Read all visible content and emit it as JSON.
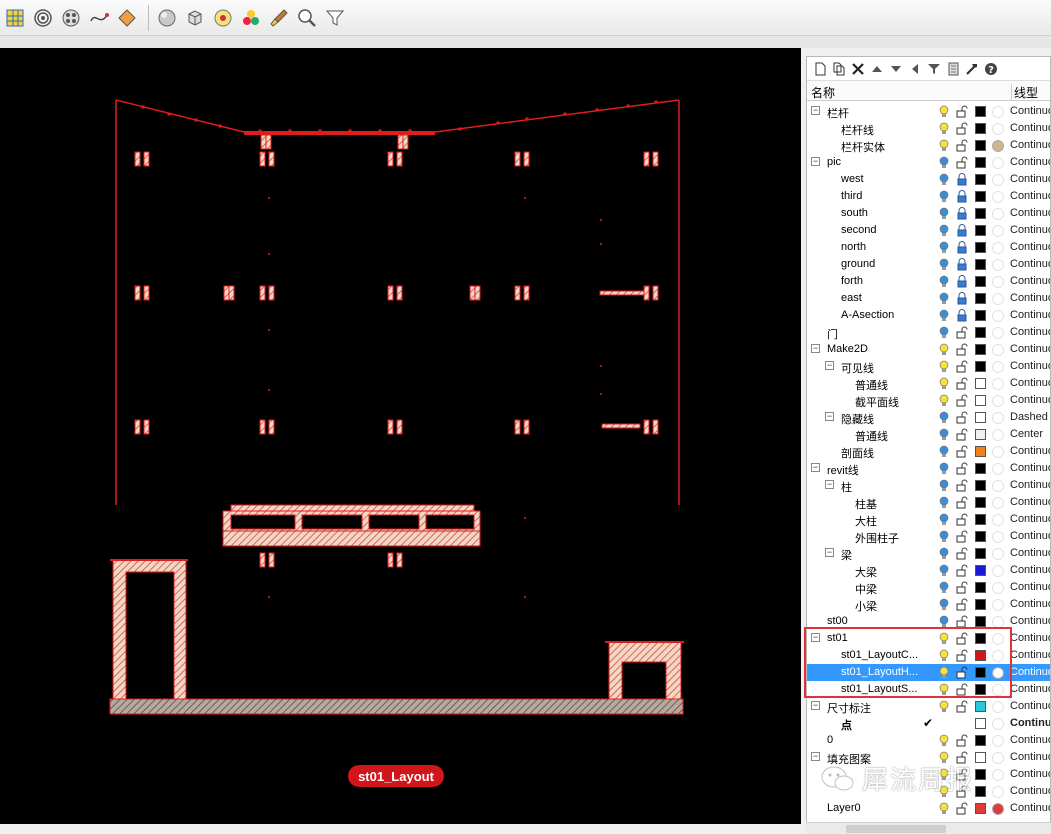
{
  "toolbar": {
    "icons": [
      "surface-grid-icon",
      "spiral-icon",
      "film-reel-icon",
      "curve-icon",
      "diamond-icon",
      "sphere-icon",
      "cube-icon",
      "render-icon",
      "materials-icon",
      "paintbrush-icon",
      "zoom-icon",
      "filter-icon"
    ]
  },
  "viewport": {
    "layout_label": "st01_Layout",
    "drawing_color": "#e01c1c",
    "hatch_color": "#f2c4a8"
  },
  "layers_panel": {
    "toolbar_icons": [
      "new-layer-icon",
      "new-sublayer-icon",
      "delete-icon",
      "move-up-icon",
      "move-down-icon",
      "move-to-parent-icon",
      "filter-icon",
      "page-icon",
      "tools-icon",
      "help-icon"
    ],
    "header": {
      "name": "名称",
      "linetype": "线型"
    },
    "rows": [
      {
        "name": "栏杆",
        "level": 0,
        "toggle": "minus",
        "bulb": "yellow",
        "lock": "open",
        "color": "#000000",
        "material": "",
        "linetype": "Continuous"
      },
      {
        "name": "栏杆线",
        "level": 1,
        "toggle": "",
        "bulb": "yellow",
        "lock": "open",
        "color": "#000000",
        "material": "",
        "linetype": "Continuous"
      },
      {
        "name": "栏杆实体",
        "level": 1,
        "toggle": "",
        "bulb": "yellow",
        "lock": "open",
        "color": "#000000",
        "material": "#d2b48c",
        "linetype": "Continuous"
      },
      {
        "name": "pic",
        "level": 0,
        "toggle": "minus",
        "bulb": "blue",
        "lock": "open",
        "color": "#000000",
        "material": "",
        "linetype": "Continuous"
      },
      {
        "name": "west",
        "level": 1,
        "toggle": "",
        "bulb": "blue",
        "lock": "closed",
        "color": "#000000",
        "material": "",
        "linetype": "Continuous"
      },
      {
        "name": "third",
        "level": 1,
        "toggle": "",
        "bulb": "blue",
        "lock": "closed",
        "color": "#000000",
        "material": "",
        "linetype": "Continuous"
      },
      {
        "name": "south",
        "level": 1,
        "toggle": "",
        "bulb": "blue",
        "lock": "closed",
        "color": "#000000",
        "material": "",
        "linetype": "Continuous"
      },
      {
        "name": "second",
        "level": 1,
        "toggle": "",
        "bulb": "blue",
        "lock": "closed",
        "color": "#000000",
        "material": "",
        "linetype": "Continuous"
      },
      {
        "name": "north",
        "level": 1,
        "toggle": "",
        "bulb": "blue",
        "lock": "closed",
        "color": "#000000",
        "material": "",
        "linetype": "Continuous"
      },
      {
        "name": "ground",
        "level": 1,
        "toggle": "",
        "bulb": "blue",
        "lock": "closed",
        "color": "#000000",
        "material": "",
        "linetype": "Continuous"
      },
      {
        "name": "forth",
        "level": 1,
        "toggle": "",
        "bulb": "blue",
        "lock": "closed",
        "color": "#000000",
        "material": "",
        "linetype": "Continuous"
      },
      {
        "name": "east",
        "level": 1,
        "toggle": "",
        "bulb": "blue",
        "lock": "closed",
        "color": "#000000",
        "material": "",
        "linetype": "Continuous"
      },
      {
        "name": "A-Asection",
        "level": 1,
        "toggle": "",
        "bulb": "blue",
        "lock": "closed",
        "color": "#000000",
        "material": "",
        "linetype": "Continuous"
      },
      {
        "name": "门",
        "level": 0,
        "toggle": "",
        "bulb": "blue",
        "lock": "open",
        "color": "#000000",
        "material": "",
        "linetype": "Continuous"
      },
      {
        "name": "Make2D",
        "level": 0,
        "toggle": "minus",
        "bulb": "yellow",
        "lock": "open",
        "color": "#000000",
        "material": "",
        "linetype": "Continuous"
      },
      {
        "name": "可见线",
        "level": 1,
        "toggle": "minus",
        "bulb": "yellow",
        "lock": "open",
        "color": "#000000",
        "material": "",
        "linetype": "Continuous"
      },
      {
        "name": "普通线",
        "level": 2,
        "toggle": "",
        "bulb": "yellow",
        "lock": "open",
        "color": "#ffffff",
        "material": "",
        "linetype": "Continuous"
      },
      {
        "name": "截平面线",
        "level": 2,
        "toggle": "",
        "bulb": "yellow",
        "lock": "open",
        "color": "#ffffff",
        "material": "",
        "linetype": "Continuous"
      },
      {
        "name": "隐藏线",
        "level": 1,
        "toggle": "minus",
        "bulb": "blue",
        "lock": "open",
        "color": "#ffffff",
        "material": "",
        "linetype": "Dashed"
      },
      {
        "name": "普通线",
        "level": 2,
        "toggle": "",
        "bulb": "blue",
        "lock": "open",
        "color": "#f0f0f0",
        "material": "",
        "linetype": "Center"
      },
      {
        "name": "剖面线",
        "level": 1,
        "toggle": "",
        "bulb": "blue",
        "lock": "open",
        "color": "#f07f1c",
        "material": "",
        "linetype": "Continuous"
      },
      {
        "name": "revit线",
        "level": 0,
        "toggle": "minus",
        "bulb": "blue",
        "lock": "open",
        "color": "#000000",
        "material": "",
        "linetype": "Continuous"
      },
      {
        "name": "柱",
        "level": 1,
        "toggle": "minus",
        "bulb": "blue",
        "lock": "open",
        "color": "#000000",
        "material": "",
        "linetype": "Continuous"
      },
      {
        "name": "柱基",
        "level": 2,
        "toggle": "",
        "bulb": "blue",
        "lock": "open",
        "color": "#000000",
        "material": "",
        "linetype": "Continuous"
      },
      {
        "name": "大柱",
        "level": 2,
        "toggle": "",
        "bulb": "blue",
        "lock": "open",
        "color": "#000000",
        "material": "",
        "linetype": "Continuous"
      },
      {
        "name": "外围柱子",
        "level": 2,
        "toggle": "",
        "bulb": "blue",
        "lock": "open",
        "color": "#000000",
        "material": "",
        "linetype": "Continuous"
      },
      {
        "name": "梁",
        "level": 1,
        "toggle": "minus",
        "bulb": "blue",
        "lock": "open",
        "color": "#000000",
        "material": "",
        "linetype": "Continuous"
      },
      {
        "name": "大梁",
        "level": 2,
        "toggle": "",
        "bulb": "blue",
        "lock": "open",
        "color": "#1a1ad6",
        "material": "",
        "linetype": "Continuous"
      },
      {
        "name": "中梁",
        "level": 2,
        "toggle": "",
        "bulb": "blue",
        "lock": "open",
        "color": "#000000",
        "material": "",
        "linetype": "Continuous"
      },
      {
        "name": "小梁",
        "level": 2,
        "toggle": "",
        "bulb": "blue",
        "lock": "open",
        "color": "#000000",
        "material": "",
        "linetype": "Continuous"
      },
      {
        "name": "st00",
        "level": 0,
        "toggle": "",
        "bulb": "blue",
        "lock": "open",
        "color": "#000000",
        "material": "",
        "linetype": "Continuous"
      },
      {
        "name": "st01",
        "level": 0,
        "toggle": "minus",
        "bulb": "yellow",
        "lock": "open",
        "color": "#000000",
        "material": "",
        "linetype": "Continuous"
      },
      {
        "name": "st01_LayoutC...",
        "level": 1,
        "toggle": "",
        "bulb": "yellow",
        "lock": "open",
        "color": "#d0151b",
        "material": "",
        "linetype": "Continuous"
      },
      {
        "name": "st01_LayoutH...",
        "level": 1,
        "toggle": "",
        "bulb": "yellow",
        "lock": "open",
        "color": "#000000",
        "material": "#ffffff",
        "linetype": "Continuous",
        "selected": true
      },
      {
        "name": "st01_LayoutS...",
        "level": 1,
        "toggle": "",
        "bulb": "yellow",
        "lock": "open",
        "color": "#000000",
        "material": "",
        "linetype": "Continuous"
      },
      {
        "name": "尺寸标注",
        "level": 0,
        "toggle": "minus",
        "bulb": "yellow",
        "lock": "open",
        "color": "#28c8d8",
        "material": "",
        "linetype": "Continuous"
      },
      {
        "name": "点",
        "level": 1,
        "toggle": "",
        "bulb": "",
        "lock": "",
        "color": "#ffffff",
        "material": "",
        "linetype": "Continuous",
        "current": true,
        "bold": true
      },
      {
        "name": "0",
        "level": 0,
        "toggle": "",
        "bulb": "yellow",
        "lock": "open",
        "color": "#000000",
        "material": "",
        "linetype": "Continuous"
      },
      {
        "name": "填充图案",
        "level": 0,
        "toggle": "minus",
        "bulb": "yellow",
        "lock": "open",
        "color": "#ffffff",
        "material": "",
        "linetype": "Continuous"
      },
      {
        "name": "",
        "level": 1,
        "toggle": "",
        "bulb": "yellow",
        "lock": "open",
        "color": "#000000",
        "material": "",
        "linetype": "Continuous"
      },
      {
        "name": "",
        "level": 1,
        "toggle": "",
        "bulb": "yellow",
        "lock": "open",
        "color": "#000000",
        "material": "",
        "linetype": "Continuous"
      },
      {
        "name": "Layer0",
        "level": 0,
        "toggle": "",
        "bulb": "yellow",
        "lock": "open",
        "color": "#e03a3a",
        "material": "#e03a3a",
        "linetype": "Continuous"
      }
    ]
  },
  "watermark": {
    "text": "犀流周报"
  }
}
